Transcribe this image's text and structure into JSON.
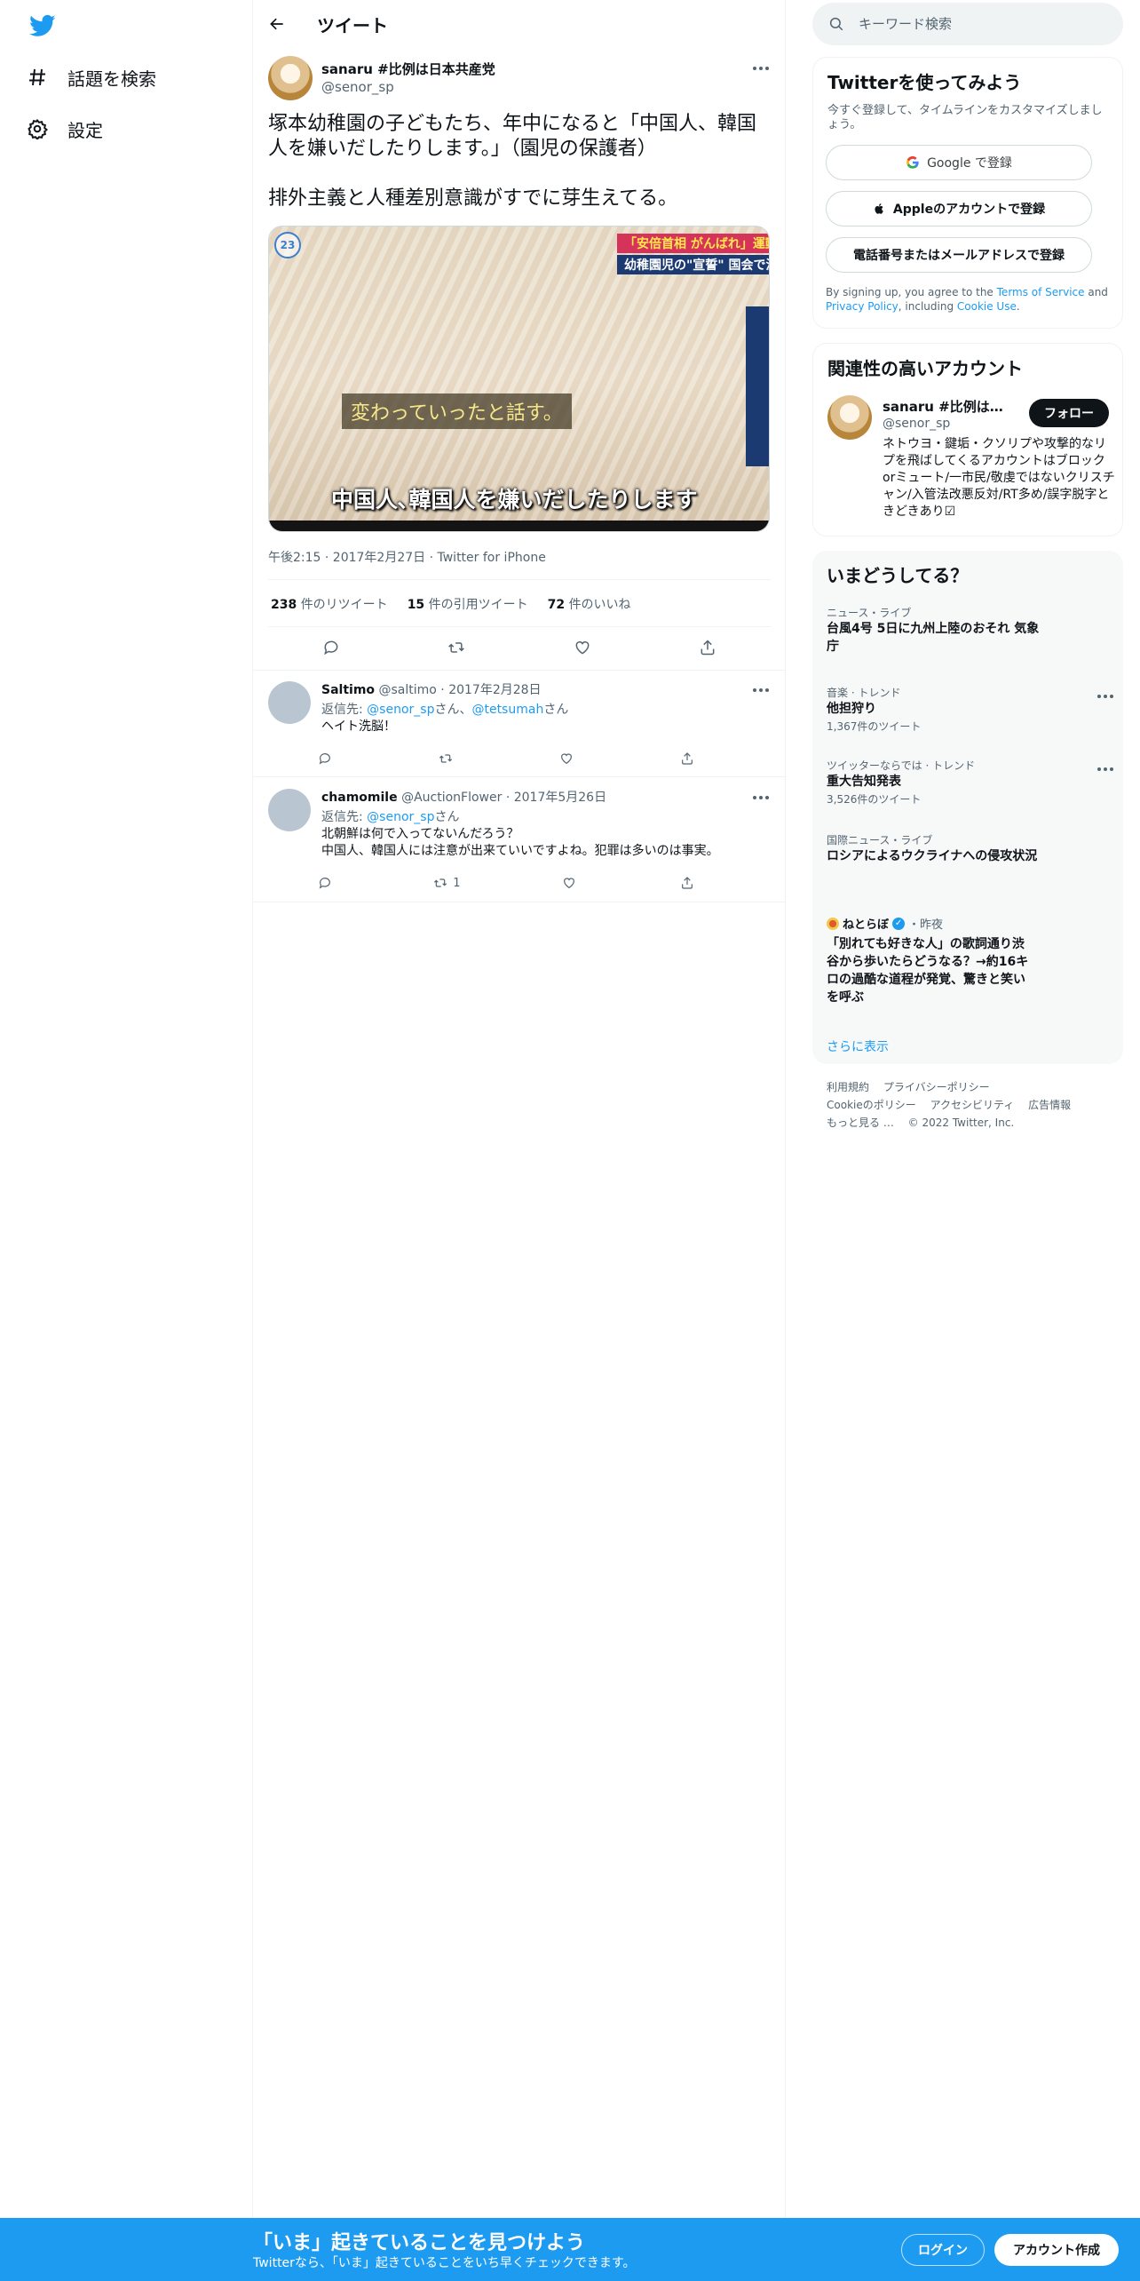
{
  "nav": {
    "items": [
      {
        "label": "話題を検索",
        "icon": "hashtag-icon"
      },
      {
        "label": "設定",
        "icon": "gear-icon"
      }
    ]
  },
  "header": {
    "title": "ツイート"
  },
  "tweet": {
    "author_name": "sanaru #比例は日本共産党",
    "author_handle": "@senor_sp",
    "text": "塚本幼稚園の子どもたち、年中になると「中国人、韓国人を嫌いだしたりします。」（園児の保護者）\n\n排外主義と人種差別意識がすでに芽生えてる。",
    "media": {
      "channel_logo": "23",
      "banner_top": "「安倍首相 がんばれ」運動会で",
      "banner_second": "幼稚園児の\"宣誓\" 国会で波",
      "caption_mid": "変わっていったと話す。",
      "caption_bottom": "中国人､韓国人を嫌いだしたりします"
    },
    "meta": "午後2:15 · 2017年2月27日 · Twitter for iPhone",
    "stats": {
      "retweets_num": "238",
      "retweets_label": "件のリツイート",
      "quotes_num": "15",
      "quotes_label": "件の引用ツイート",
      "likes_num": "72",
      "likes_label": "件のいいね"
    }
  },
  "replies": [
    {
      "name": "Saltimo",
      "handle": "@saltimo",
      "date": "2017年2月28日",
      "reply_prefix": "返信先: ",
      "reply_to": [
        "@senor_sp",
        "@tetsumah"
      ],
      "reply_suffix": "さん",
      "text": "ヘイト洗脳！",
      "retweet_count": ""
    },
    {
      "name": "chamomile",
      "handle": "@AuctionFlower",
      "date": "2017年5月26日",
      "reply_prefix": "返信先: ",
      "reply_to": [
        "@senor_sp"
      ],
      "reply_suffix": "さん",
      "text": "北朝鮮は何で入ってないんだろう？\n中国人、韓国人には注意が出来ていいですよね。犯罪は多いのは事実。",
      "retweet_count": "1"
    }
  ],
  "search": {
    "placeholder": "キーワード検索"
  },
  "signup_card": {
    "title": "Twitterを使ってみよう",
    "desc": "今すぐ登録して、タイムラインをカスタマイズしましょう。",
    "google_btn": "Google で登録",
    "apple_btn": "Appleのアカウントで登録",
    "phone_btn": "電話番号またはメールアドレスで登録",
    "terms_prefix": "By signing up, you agree to the ",
    "terms_link": "Terms of Service",
    "terms_and": " and ",
    "privacy_link": "Privacy Policy",
    "terms_including": ", including ",
    "cookie_link": "Cookie Use",
    "terms_end": "."
  },
  "related": {
    "title": "関連性の高いアカウント",
    "name": "sanaru #比例は日本共産党",
    "handle": "@senor_sp",
    "follow_btn": "フォロー",
    "bio": "ネトウヨ・鍵垢・クソリプや攻撃的なリプを飛ばしてくるアカウントはブロックorミュート/一市民/敬虔ではないクリスチャン/入管法改悪反対/RT多め/誤字脱字ときどきあり☑"
  },
  "trends": {
    "title": "いまどうしてる？",
    "items": [
      {
        "category": "ニュース・ライブ",
        "title": "台風4号 5日に九州上陸のおそれ 気象庁",
        "count": ""
      },
      {
        "category": "音楽 · トレンド",
        "title": "他担狩り",
        "count": "1,367件のツイート"
      },
      {
        "category": "ツイッターならでは · トレンド",
        "title": "重大告知発表",
        "count": "3,526件のツイート"
      },
      {
        "category": "国際ニュース・ライブ",
        "title": "ロシアによるウクライナへの侵攻状況",
        "count": ""
      }
    ],
    "news": {
      "source": "ねとらぼ",
      "time": "・昨夜",
      "title": "「別れても好きな人」の歌詞通り渋谷から歩いたらどうなる？→約16キロの過酷な道程が発覚、驚きと笑いを呼ぶ"
    },
    "show_more": "さらに表示"
  },
  "footer": {
    "terms": "利用規約",
    "privacy": "プライバシーポリシー",
    "cookie": "Cookieのポリシー",
    "accessibility": "アクセシビリティ",
    "ads": "広告情報",
    "more": "もっと見る …",
    "copyright": "© 2022 Twitter, Inc."
  },
  "bottom_bar": {
    "title": "「いま」起きていることを見つけよう",
    "subtitle": "Twitterなら、「いま」起きていることをいち早くチェックできます。",
    "login": "ログイン",
    "signup": "アカウント作成"
  },
  "colors": {
    "accent": "#1d9bf0",
    "text": "#0f1419",
    "muted": "#536471"
  }
}
